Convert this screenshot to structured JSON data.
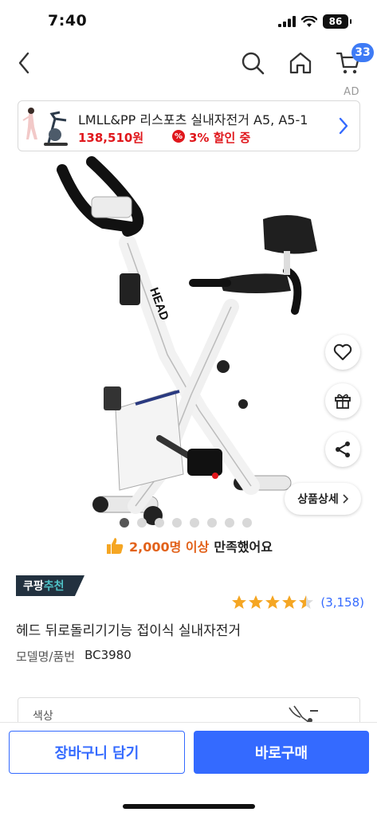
{
  "status_bar": {
    "time": "7:40",
    "battery": "86"
  },
  "nav": {
    "cart_count": "33"
  },
  "ad": {
    "label": "AD",
    "title": "LMLL&PP 리스포츠 실내자전거 A5, A5-1",
    "price": "138,510원",
    "discount": "3% 할인 중",
    "badge_glyph": "%"
  },
  "gallery": {
    "dot_count": 8,
    "active_index": 0,
    "detail_label": "상품상세"
  },
  "satisfaction": {
    "count": "2,000명 이상",
    "text": "만족했어요"
  },
  "product": {
    "recommend_badge_part1": "쿠팡",
    "recommend_badge_part2": "추천",
    "rating": 4.5,
    "review_count": "(3,158)",
    "name": "헤드 뒤로돌리기기능 접이식 실내자전거",
    "model_label": "모델명/품번",
    "model_value": "BC3980"
  },
  "option": {
    "label": "색상"
  },
  "actions": {
    "add_to_cart": "장바구니 담기",
    "buy_now": "바로구매"
  },
  "colors": {
    "accent_blue": "#346aff",
    "price_red": "#e0171c",
    "star_gold": "#f5a623"
  }
}
